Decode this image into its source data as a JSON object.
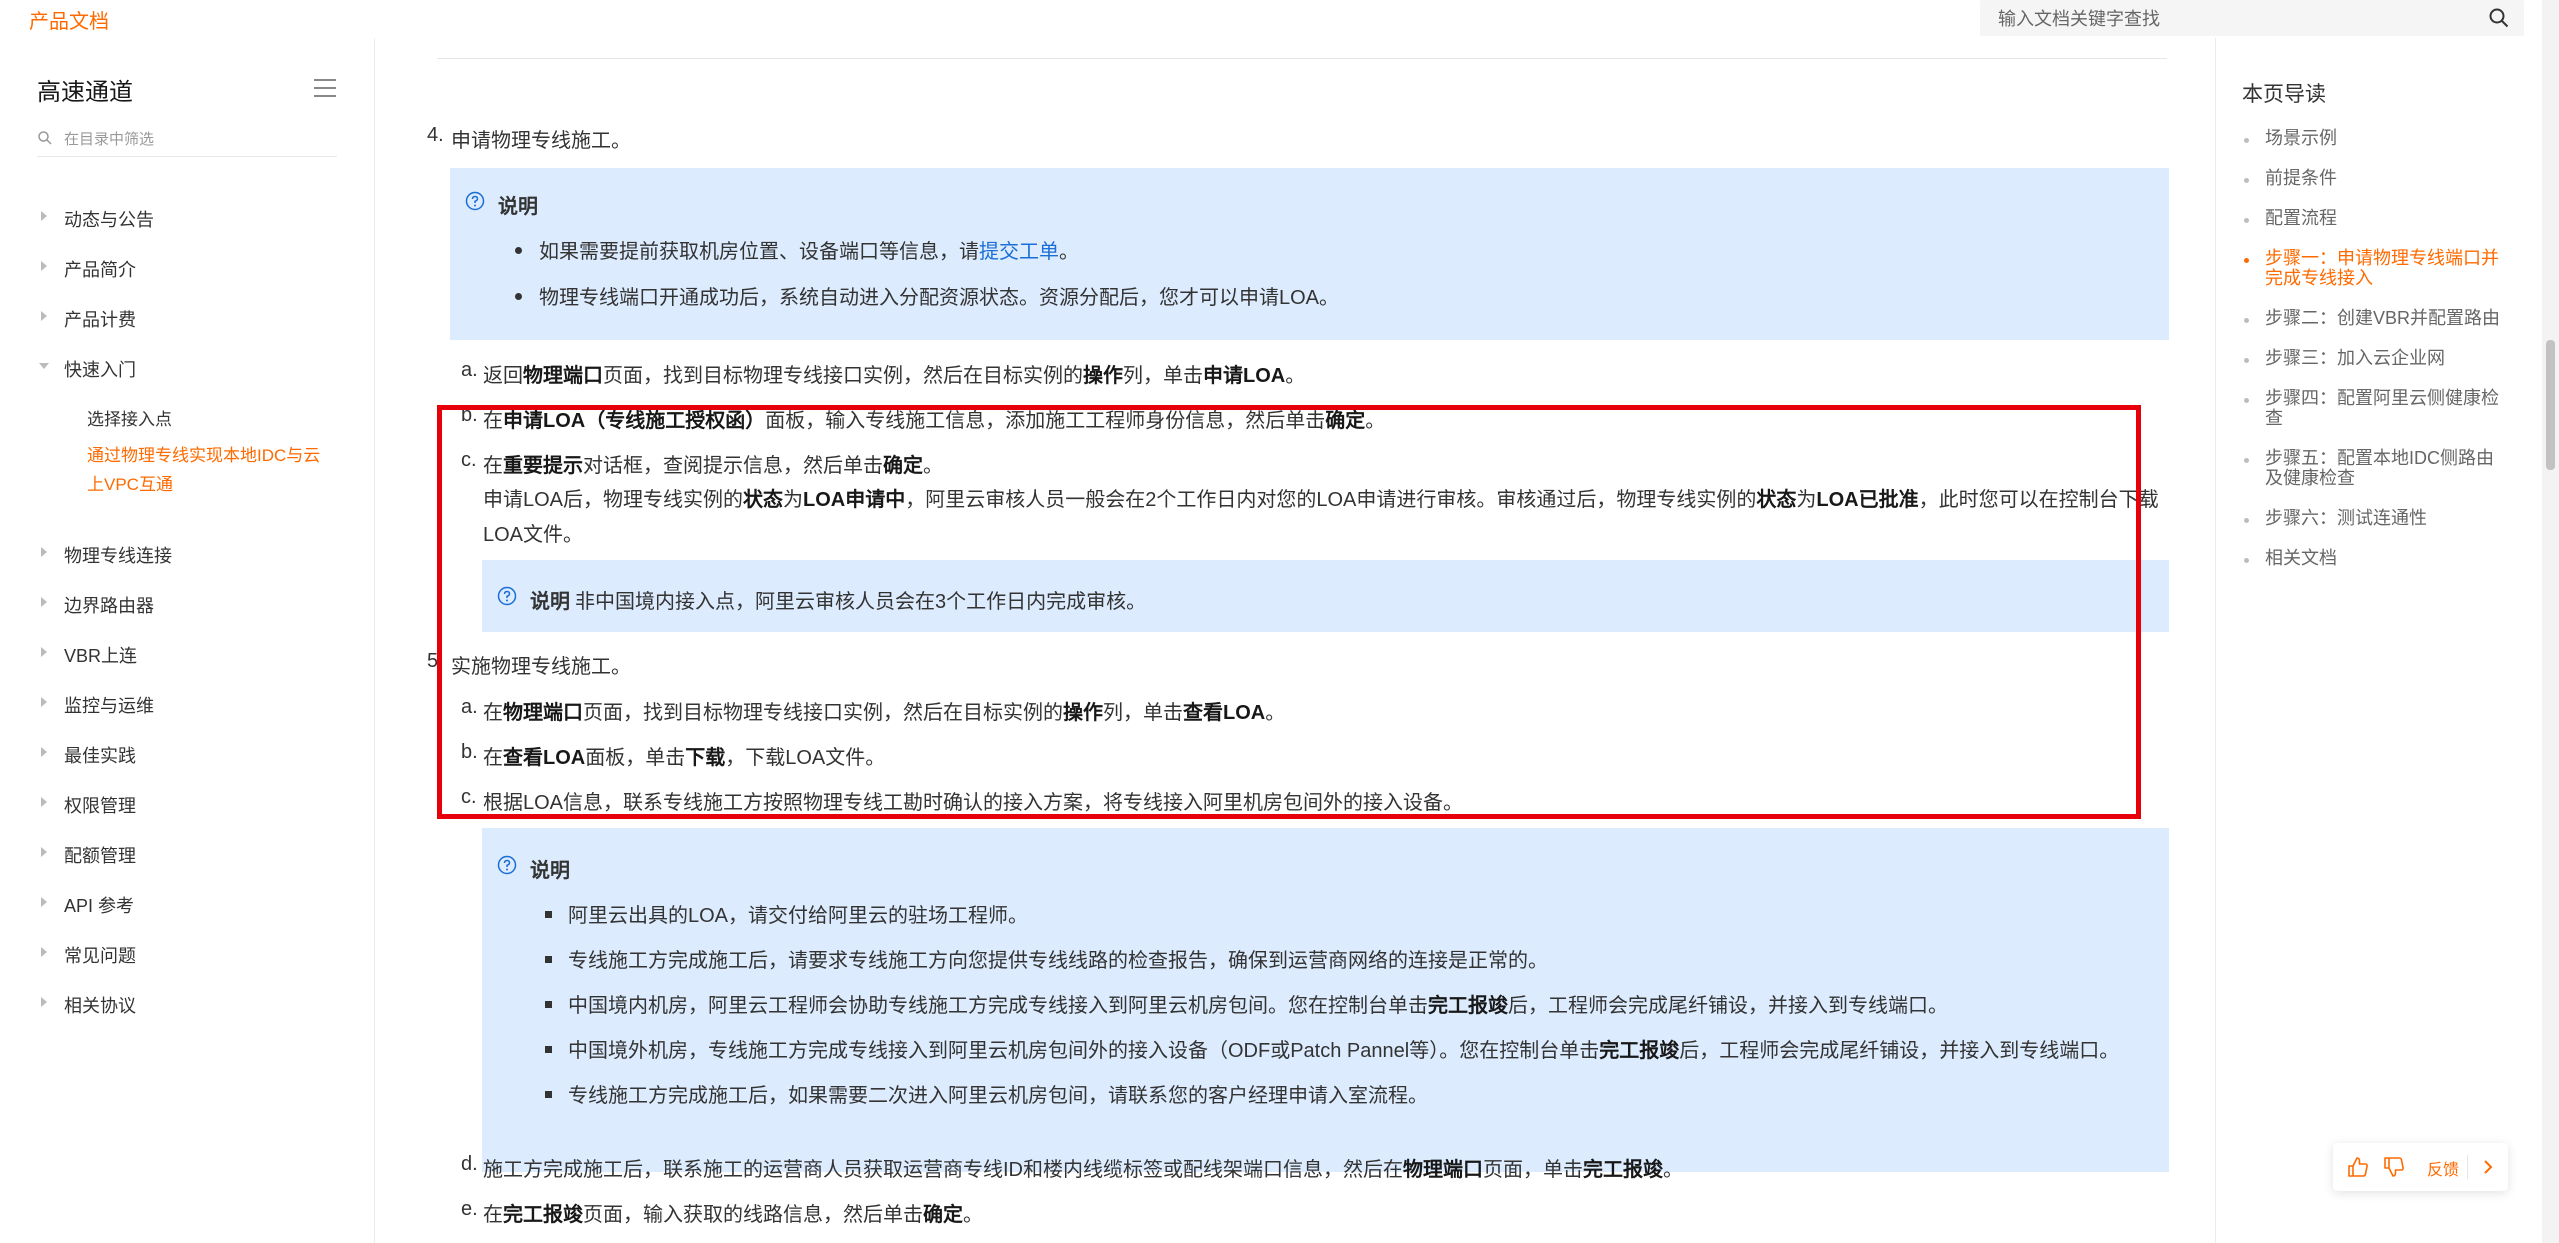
{
  "header": {
    "brand": "产品文档",
    "search_placeholder": "输入文档关键字查找"
  },
  "sidebar": {
    "title": "高速通道",
    "filter_placeholder": "在目录中筛选",
    "items": [
      {
        "label": "动态与公告"
      },
      {
        "label": "产品简介"
      },
      {
        "label": "产品计费"
      },
      {
        "label": "快速入门"
      },
      {
        "label": "物理专线连接"
      },
      {
        "label": "边界路由器"
      },
      {
        "label": "VBR上连"
      },
      {
        "label": "监控与运维"
      },
      {
        "label": "最佳实践"
      },
      {
        "label": "权限管理"
      },
      {
        "label": "配额管理"
      },
      {
        "label": "API 参考"
      },
      {
        "label": "常见问题"
      },
      {
        "label": "相关协议"
      }
    ],
    "sub_items": [
      {
        "label": "选择接入点"
      },
      {
        "label": "通过物理专线实现本地IDC与云上VPC互通"
      }
    ]
  },
  "content": {
    "step4": {
      "num": "4.",
      "text": "申请物理专线施工。"
    },
    "note1": {
      "title": "说明",
      "b1_pre": "如果需要提前获取机房位置、设备端口等信息，请",
      "b1_link": "提交工单",
      "b1_post": "。",
      "b2": "物理专线端口开通成功后，系统自动进入分配资源状态。资源分配后，您才可以申请LOA。"
    },
    "s4a": {
      "m": "a.",
      "t1": "返回",
      "b1": "物理端口",
      "t2": "页面，找到目标物理专线接口实例，然后在目标实例的",
      "b2": "操作",
      "t3": "列，单击",
      "b3": "申请LOA",
      "t4": "。"
    },
    "s4b": {
      "m": "b.",
      "t1": "在",
      "b1": "申请LOA（专线施工授权函）",
      "t2": "面板，输入专线施工信息，添加施工工程师身份信息，然后单击",
      "b2": "确定",
      "t3": "。"
    },
    "s4c": {
      "m": "c.",
      "t1": "在",
      "b1": "重要提示",
      "t2": "对话框，查阅提示信息，然后单击",
      "b2": "确定",
      "t3": "。"
    },
    "s4c_desc": {
      "t1": "申请LOA后，物理专线实例的",
      "b1": "状态",
      "t2": "为",
      "b2": "LOA申请中",
      "t3": "，阿里云审核人员一般会在2个工作日内对您的LOA申请进行审核。审核通过后，物理专线实例的",
      "b3": "状态",
      "t4": "为",
      "b4": "LOA已批准",
      "t5": "，此时您可以在控制台下载",
      "line2": "LOA文件。"
    },
    "note2": {
      "title": "说明",
      "text": "非中国境内接入点，阿里云审核人员会在3个工作日内完成审核。"
    },
    "step5": {
      "num": "5.",
      "text": "实施物理专线施工。"
    },
    "s5a": {
      "m": "a.",
      "t1": "在",
      "b1": "物理端口",
      "t2": "页面，找到目标物理专线接口实例，然后在目标实例的",
      "b2": "操作",
      "t3": "列，单击",
      "b3": "查看LOA",
      "t4": "。"
    },
    "s5b": {
      "m": "b.",
      "t1": "在",
      "b1": "查看LOA",
      "t2": "面板，单击",
      "b2": "下载",
      "t3": "，下载LOA文件。"
    },
    "s5c": {
      "m": "c.",
      "t1": "根据LOA信息，联系专线施工方按照物理专线工勘时确认的接入方案，将专线接入阿里机房包间外的接入设备。"
    },
    "note3": {
      "title": "说明",
      "b1": "阿里云出具的LOA，请交付给阿里云的驻场工程师。",
      "b2": "专线施工方完成施工后，请要求专线施工方向您提供专线线路的检查报告，确保到运营商网络的连接是正常的。",
      "b3_t1": "中国境内机房，阿里云工程师会协助专线施工方完成专线接入到阿里云机房包间。您在控制台单击",
      "b3_b1": "完工报竣",
      "b3_t2": "后，工程师会完成尾纤铺设，并接入到专线端口。",
      "b4_t1": "中国境外机房，专线施工方完成专线接入到阿里云机房包间外的接入设备（ODF或Patch Pannel等）。您在控制台单击",
      "b4_b1": "完工报竣",
      "b4_t2": "后，工程师会完成尾纤铺设，并接入到专线端口。",
      "b5": "专线施工方完成施工后，如果需要二次进入阿里云机房包间，请联系您的客户经理申请入室流程。"
    },
    "s5d": {
      "m": "d.",
      "t1": "施工方完成施工后，联系施工的运营商人员获取运营商专线ID和楼内线缆标签或配线架端口信息，然后在",
      "b1": "物理端口",
      "t2": "页面，单击",
      "b2": "完工报竣",
      "t3": "。"
    },
    "s5e": {
      "m": "e.",
      "t1": "在",
      "b1": "完工报竣",
      "t2": "页面，输入获取的线路信息，然后单击",
      "b2": "确定",
      "t3": "。"
    }
  },
  "toc": {
    "title": "本页导读",
    "items": [
      {
        "label": "场景示例"
      },
      {
        "label": "前提条件"
      },
      {
        "label": "配置流程"
      },
      {
        "label": "步骤一：申请物理专线端口并完成专线接入"
      },
      {
        "label": "步骤二：创建VBR并配置路由"
      },
      {
        "label": "步骤三：加入云企业网"
      },
      {
        "label": "步骤四：配置阿里云侧健康检查"
      },
      {
        "label": "步骤五：配置本地IDC侧路由及健康检查"
      },
      {
        "label": "步骤六：测试连通性"
      },
      {
        "label": "相关文档"
      }
    ]
  },
  "feedback": {
    "label": "反馈"
  },
  "colors": {
    "accent": "#ff6a00",
    "link": "#1a6ed8",
    "note_bg": "#dcebfd",
    "highlight": "#e5000a"
  }
}
